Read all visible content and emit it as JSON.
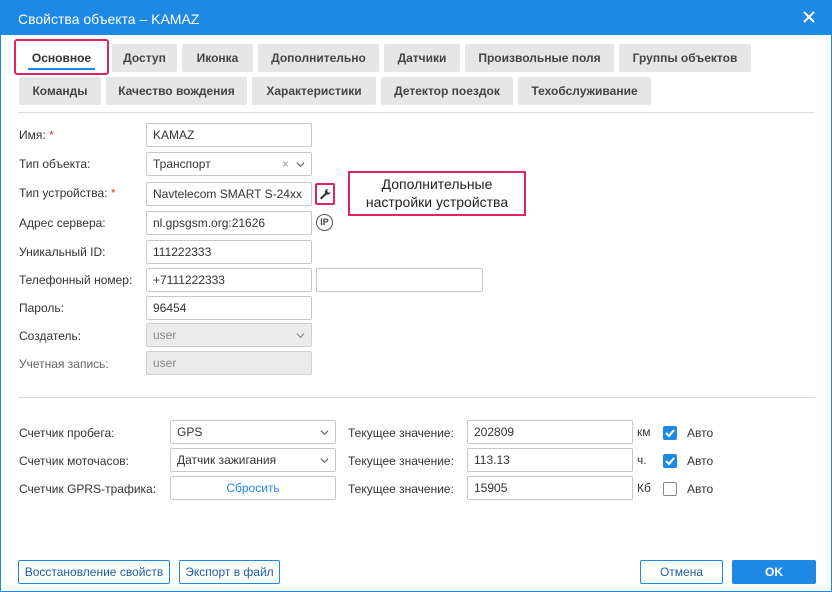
{
  "window": {
    "title": "Свойства объекта – KAMAZ"
  },
  "tabs": {
    "row1": [
      "Основное",
      "Доступ",
      "Иконка",
      "Дополнительно",
      "Датчики",
      "Произвольные поля",
      "Группы объектов"
    ],
    "row2": [
      "Команды",
      "Качество вождения",
      "Характеристики",
      "Детектор поездок",
      "Техобслуживание"
    ],
    "active": "Основное"
  },
  "form": {
    "name": {
      "label": "Имя:",
      "value": "KAMAZ",
      "required": true
    },
    "object_type": {
      "label": "Тип объекта:",
      "value": "Транспорт",
      "clear": "×"
    },
    "device_type": {
      "label": "Тип устройства:",
      "value": "Navtelecom SMART S-24xx",
      "required": true
    },
    "server_address": {
      "label": "Адрес сервера:",
      "value": "nl.gpsgsm.org:21626",
      "badge": "IP"
    },
    "unique_id": {
      "label": "Уникальный ID:",
      "value": "111222333"
    },
    "phone": {
      "label": "Телефонный номер:",
      "value": "+7111222333",
      "value2": ""
    },
    "password": {
      "label": "Пароль:",
      "value": "96454"
    },
    "creator": {
      "label": "Создатель:",
      "value": "user"
    },
    "account": {
      "label": "Учетная запись:",
      "value": "user"
    }
  },
  "callout": {
    "line1": "Дополнительные",
    "line2": "настройки устройства"
  },
  "counters": {
    "current_label": "Текущее значение:",
    "auto_label": "Авто",
    "rows": [
      {
        "label": "Счетчик пробега:",
        "value": "GPS",
        "current": "202809",
        "unit": "км",
        "auto": true
      },
      {
        "label": "Счетчик моточасов:",
        "value": "Датчик зажигания",
        "current": "113.13",
        "unit": "ч.",
        "auto": true
      },
      {
        "label": "Счетчик GPRS-трафика:",
        "button": "Сбросить",
        "current": "15905",
        "unit": "Кб",
        "auto": false
      }
    ]
  },
  "footer": {
    "restore": "Восстановление свойств",
    "export": "Экспорт в файл",
    "cancel": "Отмена",
    "ok": "OK"
  },
  "colors": {
    "accent": "#1e88e5",
    "highlight": "#e0245e",
    "tab_bg": "#e6e6e6"
  }
}
